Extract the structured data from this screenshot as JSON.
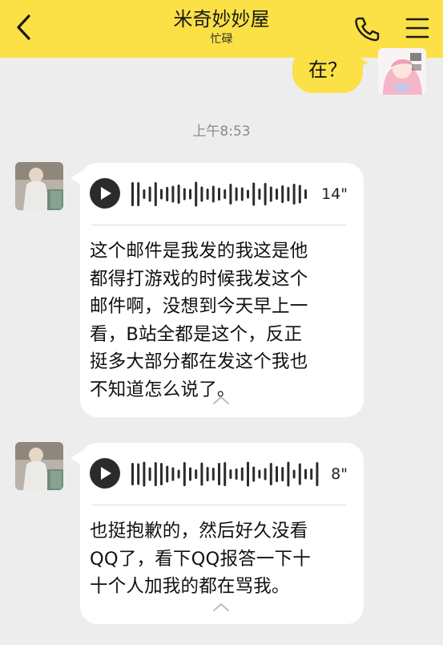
{
  "header": {
    "title": "米奇妙妙屋",
    "subtitle": "忙碌",
    "bg_color": "#fbe046"
  },
  "icons": {
    "back": "chevron-left-icon",
    "phone": "phone-icon",
    "menu": "menu-icon"
  },
  "messages": [
    {
      "type": "sent",
      "text": "在？"
    },
    {
      "type": "timestamp",
      "text": "上午8:53"
    },
    {
      "type": "voice",
      "duration": "14\"",
      "transcript": "这个邮件是我发的我这是他\n都得打游戏的时候我发这个\n邮件啊，没想到今天早上一\n看，B站全都是这个，反正\n挺多大部分都在发这个我也\n不知道怎么说了。"
    },
    {
      "type": "voice",
      "duration": "8\"",
      "transcript": "也挺抱歉的，然后好久没看\nQQ了，看下QQ报答一下十\n十个人加我的都在骂我。"
    }
  ]
}
